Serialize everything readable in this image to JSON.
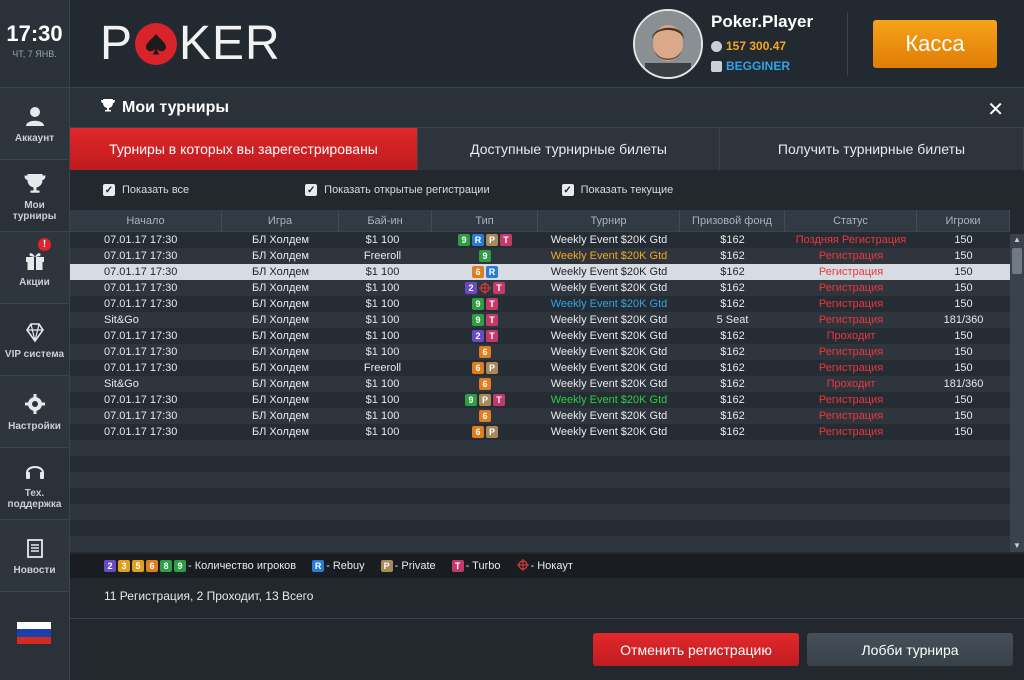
{
  "clock": {
    "time": "17:30",
    "date": "ЧТ, 7 ЯНВ."
  },
  "sidebar": {
    "items": [
      {
        "label": "Аккаунт",
        "icon": "user-icon"
      },
      {
        "label": "Мои турниры",
        "icon": "trophy-icon"
      },
      {
        "label": "Акции",
        "icon": "gift-icon",
        "badge": "!"
      },
      {
        "label": "VIP система",
        "icon": "diamond-icon"
      },
      {
        "label": "Настройки",
        "icon": "gear-icon"
      },
      {
        "label": "Тех. поддержка",
        "icon": "headset-icon"
      },
      {
        "label": "Новости",
        "icon": "news-icon"
      }
    ],
    "flag": "russia-flag-icon"
  },
  "header": {
    "logo_left": "P",
    "logo_right": "KER",
    "player_name": "Poker.Player",
    "balance": "157 300.47",
    "level": "BEGGINER",
    "cashier_label": "Касса"
  },
  "panel": {
    "title": "Мои турниры",
    "tabs": [
      {
        "label": "Турниры в которых вы зарегестрированы",
        "active": true
      },
      {
        "label": "Доступные турнирные билеты",
        "active": false
      },
      {
        "label": "Получить турнирные билеты",
        "active": false
      }
    ],
    "filters": [
      {
        "label": "Показать все",
        "checked": true
      },
      {
        "label": "Показать открытые регистрации",
        "checked": true
      },
      {
        "label": "Показать текущие",
        "checked": true
      }
    ]
  },
  "table": {
    "headers": [
      "Начало",
      "Игра",
      "Бай-ин",
      "Тип",
      "Турнир",
      "Призовой фонд",
      "Статус",
      "Игроки"
    ],
    "rows": [
      {
        "start": "07.01.17  17:30",
        "game": "БЛ Холдем",
        "buyin": "$1 100",
        "types": [
          "9",
          "R",
          "P",
          "T"
        ],
        "name": "Weekly Event $20K Gtd",
        "name_color": "#e7e9ec",
        "prize": "$162",
        "status": "Поздняя Регистрация",
        "players": "150"
      },
      {
        "start": "07.01.17  17:30",
        "game": "БЛ Холдем",
        "buyin": "Freeroll",
        "types": [
          "9"
        ],
        "name": "Weekly Event $20K Gtd",
        "name_color": "#f5a623",
        "prize": "$162",
        "status": "Регистрация",
        "players": "150"
      },
      {
        "start": "07.01.17  17:30",
        "game": "БЛ Холдем",
        "buyin": "$1 100",
        "types": [
          "6",
          "R"
        ],
        "name": "Weekly Event $20K Gtd",
        "name_color": "#1e242a",
        "prize": "$162",
        "status": "Регистрация",
        "players": "150",
        "selected": true
      },
      {
        "start": "07.01.17  17:30",
        "game": "БЛ Холдем",
        "buyin": "$1 100",
        "types": [
          "2",
          "K",
          "T"
        ],
        "name": "Weekly Event $20K Gtd",
        "name_color": "#e7e9ec",
        "prize": "$162",
        "status": "Регистрация",
        "players": "150"
      },
      {
        "start": "07.01.17  17:30",
        "game": "БЛ Холдем",
        "buyin": "$1 100",
        "types": [
          "9",
          "T"
        ],
        "name": "Weekly Event $20K Gtd",
        "name_color": "#2fa3e6",
        "prize": "$162",
        "status": "Регистрация",
        "players": "150"
      },
      {
        "start": "Sit&Go",
        "game": "БЛ Холдем",
        "buyin": "$1 100",
        "types": [
          "9",
          "T"
        ],
        "name": "Weekly Event $20K Gtd",
        "name_color": "#e7e9ec",
        "prize": "5 Seat",
        "status": "Регистрация",
        "players": "181/360"
      },
      {
        "start": "07.01.17  17:30",
        "game": "БЛ Холдем",
        "buyin": "$1 100",
        "types": [
          "2",
          "T"
        ],
        "name": "Weekly Event $20K Gtd",
        "name_color": "#e7e9ec",
        "prize": "$162",
        "status": "Проходит",
        "players": "150"
      },
      {
        "start": "07.01.17  17:30",
        "game": "БЛ Холдем",
        "buyin": "$1 100",
        "types": [
          "6"
        ],
        "name": "Weekly Event $20K Gtd",
        "name_color": "#e7e9ec",
        "prize": "$162",
        "status": "Регистрация",
        "players": "150"
      },
      {
        "start": "07.01.17  17:30",
        "game": "БЛ Холдем",
        "buyin": "Freeroll",
        "types": [
          "6",
          "P"
        ],
        "name": "Weekly Event $20K Gtd",
        "name_color": "#e7e9ec",
        "prize": "$162",
        "status": "Регистрация",
        "players": "150"
      },
      {
        "start": "Sit&Go",
        "game": "БЛ Холдем",
        "buyin": "$1 100",
        "types": [
          "6"
        ],
        "name": "Weekly Event $20K Gtd",
        "name_color": "#e7e9ec",
        "prize": "$162",
        "status": "Проходит",
        "players": "181/360"
      },
      {
        "start": "07.01.17  17:30",
        "game": "БЛ Холдем",
        "buyin": "$1 100",
        "types": [
          "9",
          "P",
          "T"
        ],
        "name": "Weekly Event $20K Gtd",
        "name_color": "#2ecc40",
        "prize": "$162",
        "status": "Регистрация",
        "players": "150"
      },
      {
        "start": "07.01.17  17:30",
        "game": "БЛ Холдем",
        "buyin": "$1 100",
        "types": [
          "6"
        ],
        "name": "Weekly Event $20K Gtd",
        "name_color": "#e7e9ec",
        "prize": "$162",
        "status": "Регистрация",
        "players": "150"
      },
      {
        "start": "07.01.17  17:30",
        "game": "БЛ Холдем",
        "buyin": "$1 100",
        "types": [
          "6",
          "P"
        ],
        "name": "Weekly Event $20K Gtd",
        "name_color": "#e7e9ec",
        "prize": "$162",
        "status": "Регистрация",
        "players": "150"
      }
    ]
  },
  "legend": {
    "players_badges": [
      "2",
      "3",
      "5",
      "6",
      "8",
      "9"
    ],
    "players_label": "- Количество игроков",
    "rebuy_label": "- Rebuy",
    "private_label": "- Private",
    "turbo_label": "- Turbo",
    "knockout_label": "- Нокаут"
  },
  "summary": "11  Регистрация, 2  Проходит, 13  Всего",
  "buttons": {
    "cancel": "Отменить регистрацию",
    "lobby": "Лобби турнира"
  },
  "colors": {
    "accent_red": "#d8232a",
    "accent_orange": "#f5a623",
    "status_red": "#e8383d",
    "badge_colors": {
      "2": "#6a4bc4",
      "3": "#e0a020",
      "5": "#e0a020",
      "6": "#e07d20",
      "8": "#2e9e44",
      "9": "#2e9e44",
      "R": "#2a7bd5",
      "P": "#a68a5a",
      "T": "#c23a6a",
      "K": "#c93a3a"
    }
  }
}
